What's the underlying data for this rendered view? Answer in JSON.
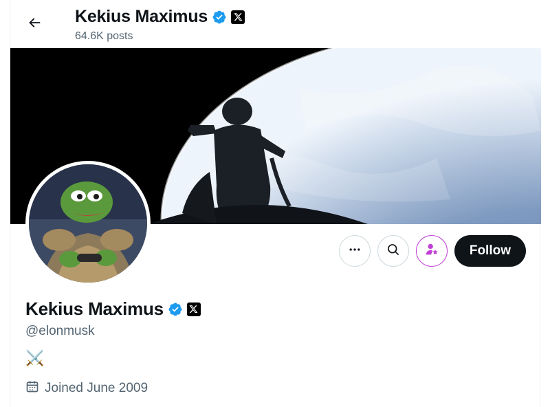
{
  "header": {
    "back_icon": "arrow-left-icon",
    "title": "Kekius Maximus",
    "posts_count": "64.6K posts"
  },
  "profile": {
    "name": "Kekius Maximus",
    "handle": "@elonmusk",
    "bio": "⚔️",
    "joined": "Joined June 2009",
    "verified": true,
    "affiliate_badge": "x-logo-icon"
  },
  "actions": {
    "more_icon": "more-icon",
    "search_icon": "search-icon",
    "subscribe_icon": "subscribe-star-icon",
    "follow_label": "Follow"
  },
  "colors": {
    "verified_blue": "#1d9bf0",
    "follow_bg": "#0f1419",
    "subscribe_accent": "#c13fd6",
    "secondary_text": "#536471"
  }
}
